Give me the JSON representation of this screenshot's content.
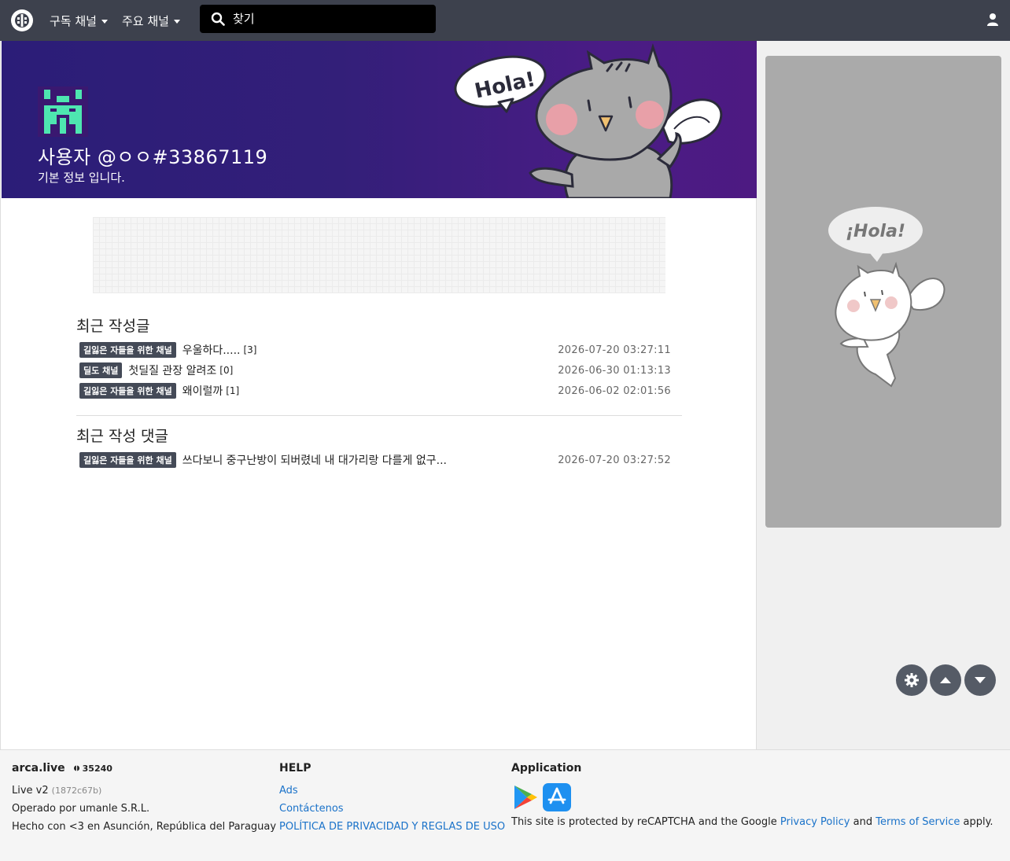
{
  "navbar": {
    "menu_subscribed": "구독 채널",
    "menu_main": "주요 채널",
    "search_placeholder": "찾기"
  },
  "profile": {
    "username": "사용자 @ㅇㅇ#33867119",
    "subtitle": "기본 정보 입니다.",
    "banner_bubble_text": "Hola!"
  },
  "recent_posts": {
    "title": "최근 작성글",
    "items": [
      {
        "channel": "길잃은 자들을 위한 채널",
        "title": "우울하다.....",
        "count": "[3]",
        "time": "2026-07-20 03:27:11"
      },
      {
        "channel": "딜도 채널",
        "title": "첫딜질 관장 알려조",
        "count": "[0]",
        "time": "2026-06-30 01:13:13"
      },
      {
        "channel": "길잃은 자들을 위한 채널",
        "title": "왜이럴까",
        "count": "[1]",
        "time": "2026-06-02 02:01:56"
      }
    ]
  },
  "recent_comments": {
    "title": "최근 작성 댓글",
    "items": [
      {
        "channel": "길잃은 자들을 위한 채널",
        "title": "쓰다보니 중구난방이 되버렸네 내 대가리랑 다를게 없구...",
        "time": "2026-07-20 03:27:52"
      }
    ]
  },
  "sidebar": {
    "ad_bubble_text": "¡Hola!"
  },
  "footer": {
    "site_name": "arca.live",
    "user_count": "35240",
    "version": "Live v2",
    "version_hash": "(1872c67b)",
    "operated_by": "Operado por umanle S.R.L.",
    "made_with": "Hecho con <3 en Asunción, República del Paraguay",
    "help_title": "HELP",
    "help_links": [
      "Ads",
      "Contáctenos",
      "POLÍTICA DE PRIVACIDAD Y REGLAS DE USO"
    ],
    "app_title": "Application",
    "recaptcha_prefix": "This site is protected by reCAPTCHA and the Google",
    "privacy_link": "Privacy Policy",
    "and_text": "and",
    "terms_link": "Terms of Service",
    "apply_text": "apply."
  },
  "colors": {
    "navbar_bg": "#3d414d",
    "banner_start": "#2b1d78",
    "banner_end": "#4d1a82",
    "badge_bg": "#444a57",
    "link": "#1a72c9",
    "avatar_green": "#4ee6b0"
  },
  "icons": [
    "arca-logo-icon",
    "search-icon",
    "user-icon",
    "gear-icon",
    "arrow-up-icon",
    "arrow-down-icon",
    "google-play-icon",
    "app-store-icon"
  ]
}
